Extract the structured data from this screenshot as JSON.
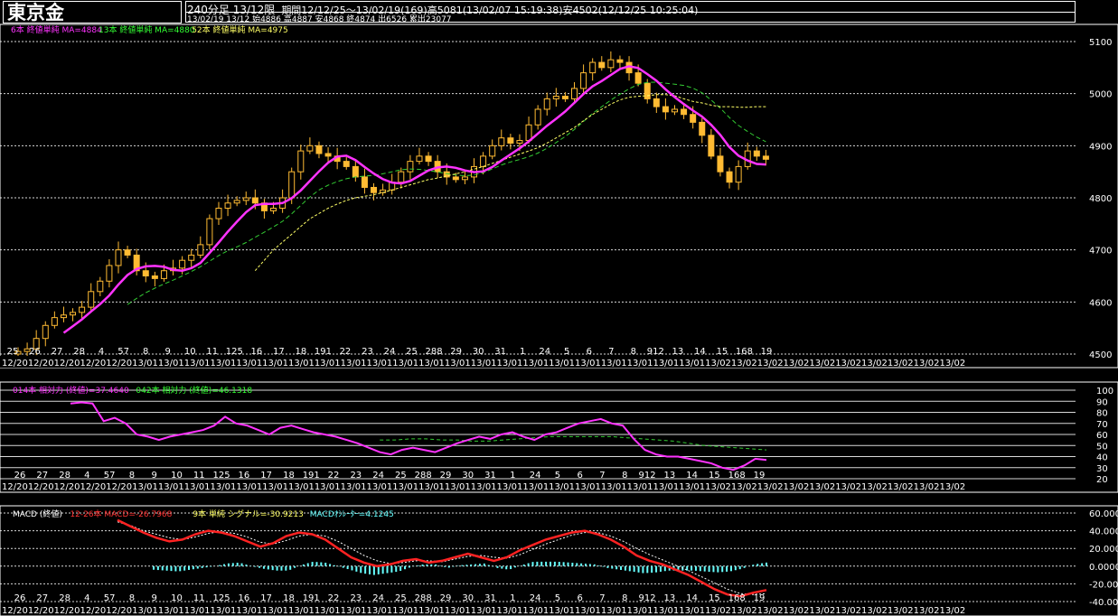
{
  "header": {
    "title": "東京金",
    "line1a": "240分足 13/12限",
    "line1b": "期間12/12/25～13/02/19(169)高5081(13/02/07 15:19:38)安4502(12/12/25 10:25:04)",
    "line2": "13/02/19 13/12 始4886 高4887 安4868 終4874 出6526 累出23077"
  },
  "main_legend": [
    {
      "text": "6本 終値単純 MA=4884",
      "color": "#ff33ff"
    },
    {
      "text": "13本 終値単純 MA=4880",
      "color": "#33ff33"
    },
    {
      "text": "52本 終値単純 MA=4975",
      "color": "#ffff66"
    }
  ],
  "rsi_legend": [
    {
      "text": "014本 相対力 (終値)=37.4640",
      "color": "#ff33ff"
    },
    {
      "text": "042本 相対力 (終値)=46.1318",
      "color": "#33ff33"
    }
  ],
  "macd_legend": [
    {
      "text": "MACD (終値)",
      "color": "#ffffff"
    },
    {
      "text": "12-26本 MACD=-26.7968",
      "color": "#ff3333"
    },
    {
      "text": "9本 単純 シグナル=-30.9213",
      "color": "#ffff66"
    },
    {
      "text": "MACDｵｼﾚｰﾀｰ=4.1245",
      "color": "#66ffff"
    }
  ],
  "colors": {
    "candle": "#ffbb33",
    "ma6": "#ff33ff",
    "ma13": "#33cc33",
    "ma52": "#ffff66",
    "macd": "#ff2222",
    "signal": "#ffffff",
    "hist": "#66ffff",
    "grid": "#ffffff"
  },
  "date_labels": [
    "25",
    "26",
    "27",
    "28",
    "4",
    "57",
    "8",
    "9",
    "10",
    "11",
    "125",
    "16",
    "17",
    "18",
    "191",
    "22",
    "23",
    "24",
    "25",
    "288",
    "29",
    "30",
    "31",
    "1",
    "24",
    "5",
    "6",
    "7",
    "8",
    "912",
    "13",
    "14",
    "15",
    "168",
    "19"
  ],
  "date_labels_lower": [
    "26",
    "27",
    "28",
    "4",
    "57",
    "8",
    "9",
    "10",
    "11",
    "125",
    "16",
    "17",
    "18",
    "191",
    "22",
    "23",
    "24",
    "25",
    "288",
    "29",
    "30",
    "31",
    "1",
    "24",
    "5",
    "6",
    "7",
    "8",
    "912",
    "13",
    "14",
    "15",
    "168",
    "19"
  ],
  "strip_text": "12/2012/2012/2012/2012/2013/0113/0113/0113/0113/0113/0113/0113/0113/0113/0113/0113/0113/0113/0113/0113/0113/0113/0113/0113/0113/0113/0113/0213/0213/0213/0213/0213/0213/0213/0213/0213/02",
  "chart_data": [
    {
      "type": "candlestick",
      "title": "東京金 240分足 13/12限",
      "ylim": [
        4500,
        5100
      ],
      "yticks": [
        "5100",
        "5000",
        "4900",
        "4800",
        "4700",
        "4600",
        "4500"
      ],
      "grid": true,
      "close": [
        4505,
        4510,
        4530,
        4555,
        4570,
        4575,
        4580,
        4590,
        4620,
        4640,
        4670,
        4700,
        4690,
        4660,
        4650,
        4645,
        4660,
        4665,
        4680,
        4690,
        4710,
        4760,
        4780,
        4790,
        4795,
        4800,
        4790,
        4775,
        4780,
        4800,
        4850,
        4890,
        4900,
        4885,
        4880,
        4870,
        4860,
        4840,
        4820,
        4810,
        4815,
        4830,
        4850,
        4870,
        4880,
        4870,
        4850,
        4840,
        4835,
        4840,
        4860,
        4880,
        4900,
        4915,
        4905,
        4910,
        4940,
        4970,
        4990,
        4995,
        4990,
        5010,
        5040,
        5060,
        5050,
        5065,
        5060,
        5040,
        5020,
        4990,
        4975,
        4965,
        4970,
        4960,
        4945,
        4920,
        4880,
        4850,
        4830,
        4860,
        4890,
        4880,
        4874
      ],
      "ma52": [
        null,
        null,
        null,
        null,
        null,
        null,
        null,
        null,
        null,
        null,
        null,
        null,
        null,
        null,
        null,
        null,
        null,
        null,
        null,
        null,
        null,
        null,
        null,
        null,
        null,
        null,
        4660,
        4680,
        4700,
        4715,
        4730,
        4745,
        4760,
        4770,
        4780,
        4788,
        4795,
        4800,
        4803,
        4806,
        4810,
        4815,
        4820,
        4825,
        4830,
        4835,
        4838,
        4842,
        4846,
        4850,
        4855,
        4860,
        4866,
        4872,
        4878,
        4884,
        4890,
        4896,
        4905,
        4915,
        4925,
        4935,
        4948,
        4960,
        4970,
        4980,
        4988,
        4993,
        4995,
        4996,
        4998,
        4998,
        4996,
        4990,
        4985,
        4982,
        4978,
        4975,
        4975,
        4974,
        4974,
        4975,
        4975
      ]
    },
    {
      "type": "line",
      "title": "相対力",
      "ylim": [
        20,
        100
      ],
      "yticks": [
        "100",
        "90",
        "80",
        "70",
        "60",
        "50",
        "40",
        "30",
        "20"
      ],
      "series": [
        {
          "name": "014本 相対力 (終値)",
          "values": [
            88,
            89,
            88,
            72,
            75,
            70,
            60,
            58,
            55,
            58,
            60,
            62,
            64,
            68,
            76,
            70,
            68,
            64,
            60,
            66,
            68,
            65,
            62,
            60,
            58,
            55,
            52,
            48,
            44,
            42,
            46,
            48,
            46,
            44,
            48,
            52,
            55,
            58,
            56,
            60,
            62,
            58,
            55,
            60,
            62,
            66,
            70,
            72,
            74,
            70,
            68,
            56,
            46,
            42,
            40,
            40,
            38,
            36,
            34,
            30,
            28,
            32,
            38,
            37
          ]
        },
        {
          "name": "042本 相対力 (終値)",
          "values": [
            null,
            null,
            null,
            null,
            null,
            null,
            null,
            null,
            null,
            null,
            null,
            null,
            null,
            null,
            null,
            null,
            null,
            null,
            null,
            null,
            55,
            55,
            56,
            56,
            55,
            55,
            54,
            54,
            55,
            56,
            57,
            58,
            58,
            58,
            58,
            58,
            57,
            56,
            55,
            54,
            52,
            50,
            49,
            48,
            47,
            46
          ]
        }
      ]
    },
    {
      "type": "line",
      "title": "MACD (終値)",
      "ylim": [
        -40,
        60
      ],
      "yticks": [
        "60.0000",
        "40.0000",
        "20.0000",
        "0.0000",
        "-20.0000",
        "-40.0000"
      ],
      "series": [
        {
          "name": "12-26本 MACD",
          "values": [
            52,
            45,
            38,
            32,
            28,
            30,
            36,
            40,
            38,
            34,
            28,
            22,
            26,
            34,
            38,
            36,
            30,
            20,
            10,
            4,
            0,
            2,
            6,
            8,
            4,
            6,
            10,
            14,
            10,
            6,
            10,
            18,
            24,
            30,
            34,
            38,
            40,
            36,
            30,
            22,
            12,
            6,
            2,
            -4,
            -10,
            -18,
            -26,
            -32,
            -34,
            -30,
            -27
          ]
        },
        {
          "name": "9本 単純 シグナル",
          "values": [
            50,
            46,
            40,
            36,
            32,
            30,
            33,
            37,
            39,
            37,
            33,
            27,
            25,
            29,
            34,
            36,
            34,
            28,
            20,
            12,
            6,
            3,
            4,
            6,
            6,
            5,
            8,
            11,
            12,
            10,
            9,
            13,
            19,
            25,
            30,
            35,
            38,
            38,
            34,
            28,
            20,
            13,
            7,
            1,
            -5,
            -12,
            -19,
            -26,
            -31,
            -32,
            -31
          ]
        },
        {
          "name": "MACDｵｼﾚｰﾀｰ",
          "values": [
            -4,
            -5,
            -6,
            -4,
            -2,
            0,
            3,
            4,
            0,
            -3,
            -5,
            -5,
            1,
            5,
            4,
            0,
            -4,
            -8,
            -10,
            -8,
            -6,
            -1,
            2,
            2,
            -2,
            1,
            2,
            3,
            -2,
            -4,
            1,
            5,
            5,
            5,
            4,
            3,
            2,
            -2,
            -4,
            -6,
            -8,
            -7,
            -5,
            -5,
            -5,
            -6,
            -7,
            -6,
            -3,
            2,
            4
          ]
        }
      ]
    }
  ]
}
